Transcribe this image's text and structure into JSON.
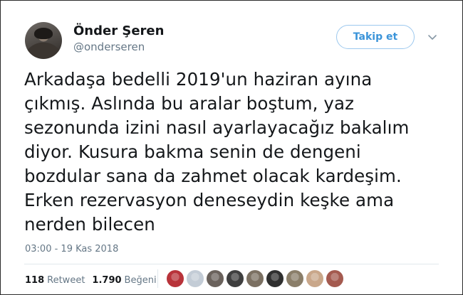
{
  "user": {
    "display_name": "Önder Şeren",
    "handle": "@onderseren",
    "avatar_icon": "profile-photo"
  },
  "follow_button": {
    "label": "Takip et"
  },
  "menu_icon": "chevron-down-icon",
  "tweet": {
    "lines": [
      "Arkadaşa bedelli 2019'un haziran ayına",
      "çıkmış. Aslında bu aralar boştum, yaz",
      "sezonunda izini nasıl ayarlayacağız bakalım",
      "diyor. Kusura bakma senin de dengeni",
      "bozdular sana da zahmet olacak kardeşim.",
      "Erken rezervasyon deneseydin keşke ama",
      "nerden bilecen"
    ],
    "timestamp": "03:00 - 19 Kas 2018"
  },
  "stats": {
    "retweets_count": "118",
    "retweets_label": "Retweet",
    "likes_count": "1.790",
    "likes_label": "Beğeni"
  },
  "likers": [
    {
      "color": "#b8333a"
    },
    {
      "color": "#c3ccd6"
    },
    {
      "color": "#6a625c"
    },
    {
      "color": "#3f3f3f"
    },
    {
      "color": "#7b7062"
    },
    {
      "color": "#2f2f2f"
    },
    {
      "color": "#8a7e69"
    },
    {
      "color": "#c9a78a"
    },
    {
      "color": "#a45a4f"
    }
  ]
}
